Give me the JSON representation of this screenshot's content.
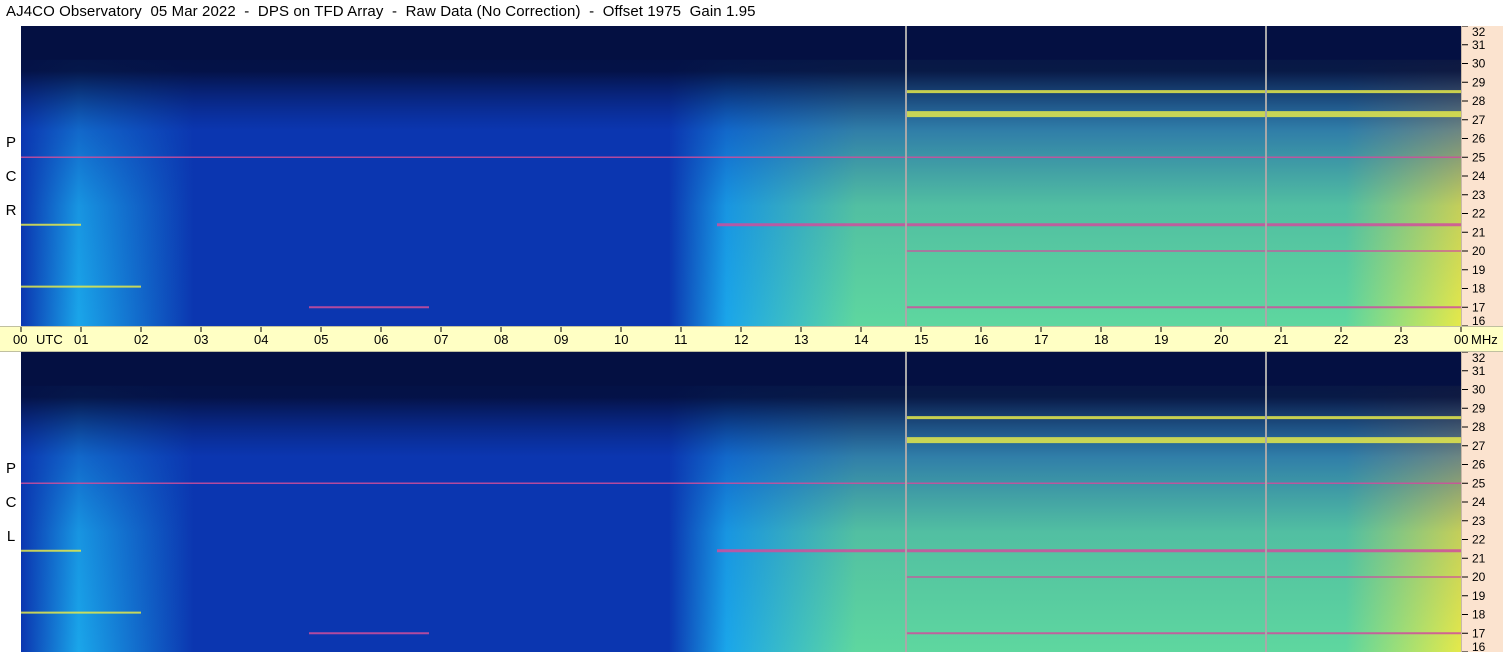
{
  "title": "AJ4CO Observatory  05 Mar 2022  -  DPS on TFD Array  -  Raw Data (No Correction)  -  Offset 1975  Gain 1.95",
  "panels": [
    {
      "name": "top",
      "polarization_letters": [
        "R",
        "C",
        "P"
      ]
    },
    {
      "name": "bottom",
      "polarization_letters": [
        "L",
        "C",
        "P"
      ]
    }
  ],
  "time_axis": {
    "start_label": "00",
    "utc_label": "UTC",
    "hour_labels": [
      "01",
      "02",
      "03",
      "04",
      "05",
      "06",
      "07",
      "08",
      "09",
      "10",
      "11",
      "12",
      "13",
      "14",
      "15",
      "16",
      "17",
      "18",
      "19",
      "20",
      "21",
      "22",
      "23"
    ],
    "end_label": "00",
    "unit_label": "MHz"
  },
  "freq_axis": {
    "labels": [
      "32",
      "31",
      "30",
      "29",
      "28",
      "27",
      "26",
      "25",
      "24",
      "23",
      "22",
      "21",
      "20",
      "19",
      "18",
      "17",
      "16"
    ],
    "min_mhz": 16,
    "max_mhz": 32
  },
  "markers_utc": [
    14.75,
    20.75
  ],
  "colors": {
    "freq_axis_bg": "#fbe3cf",
    "time_axis_bg": "#ffffc4",
    "marker": "#a8a8a8",
    "night": "#041042",
    "midnight_blue": "#0b36b0",
    "day": "#1aa6ea",
    "day_green": "#5ed79f",
    "band_yellow": "#e5e94a",
    "band_magenta": "#d04e9c"
  }
}
